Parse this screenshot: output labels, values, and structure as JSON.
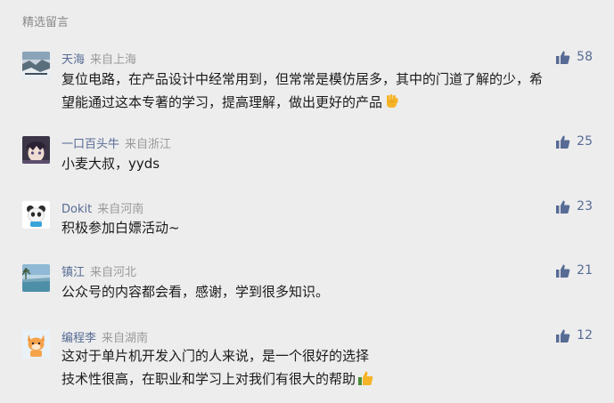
{
  "section": {
    "title": "精选留言"
  },
  "comments": [
    {
      "nickname": "天海",
      "location": "来自上海",
      "likes": "58",
      "text_lines": [
        "复位电路，在产品设计中经常用到，但常常是模仿居多，其中的门道了解的少，希",
        "望能通过这本专著的学习，提高理解，做出更好的产品"
      ],
      "emoji": "raised-hand-emoji"
    },
    {
      "nickname": "一口百头牛",
      "location": "来自浙江",
      "likes": "25",
      "text_lines": [
        "小麦大叔，yyds"
      ]
    },
    {
      "nickname": "Dokit",
      "location": "来自河南",
      "likes": "23",
      "text_lines": [
        "积极参加白嫖活动~"
      ]
    },
    {
      "nickname": "镇江",
      "location": "来自河北",
      "likes": "21",
      "text_lines": [
        "公众号的内容都会看，感谢，学到很多知识。"
      ]
    },
    {
      "nickname": "编程李",
      "location": "来自湖南",
      "likes": "12",
      "text_lines": [
        "这对于单片机开发入门的人来说，是一个很好的选择",
        "技术性很高，在职业和学习上对我们有很大的帮助"
      ],
      "emoji": "thumbs-up-emoji"
    }
  ],
  "colors": {
    "background": "#ededed",
    "nickname": "#576b95",
    "meta_gray": "#9a9a9a",
    "like": "#576b95"
  },
  "icons": {
    "like": "thumbs-up-icon"
  }
}
